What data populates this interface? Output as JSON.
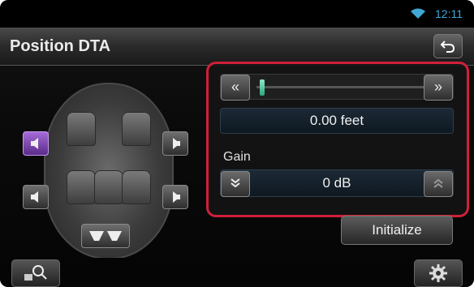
{
  "status": {
    "time": "12:11",
    "wifi_icon": "wifi-icon"
  },
  "header": {
    "title": "Position DTA",
    "back_icon": "back-arrow-icon"
  },
  "position": {
    "distance_value": "0.00 feet",
    "left_arrow": "«",
    "right_arrow": "»",
    "slider_level": 0.02
  },
  "gain": {
    "label": "Gain",
    "value": "0 dB",
    "down_icon": "double-chevron-down-icon",
    "up_icon": "double-chevron-up-icon"
  },
  "buttons": {
    "initialize_label": "Initialize"
  },
  "speakers": {
    "selected": "front-left",
    "items": [
      "front-left",
      "front-right",
      "rear-left",
      "rear-right",
      "subwoofer"
    ]
  },
  "bottom": {
    "left_icon": "zoom-icon",
    "right_icon": "settings-gear-icon"
  },
  "colors": {
    "highlight_border": "#d0203a",
    "selected_speaker": "#8a4ac4",
    "time_text": "#3fa8d6"
  }
}
